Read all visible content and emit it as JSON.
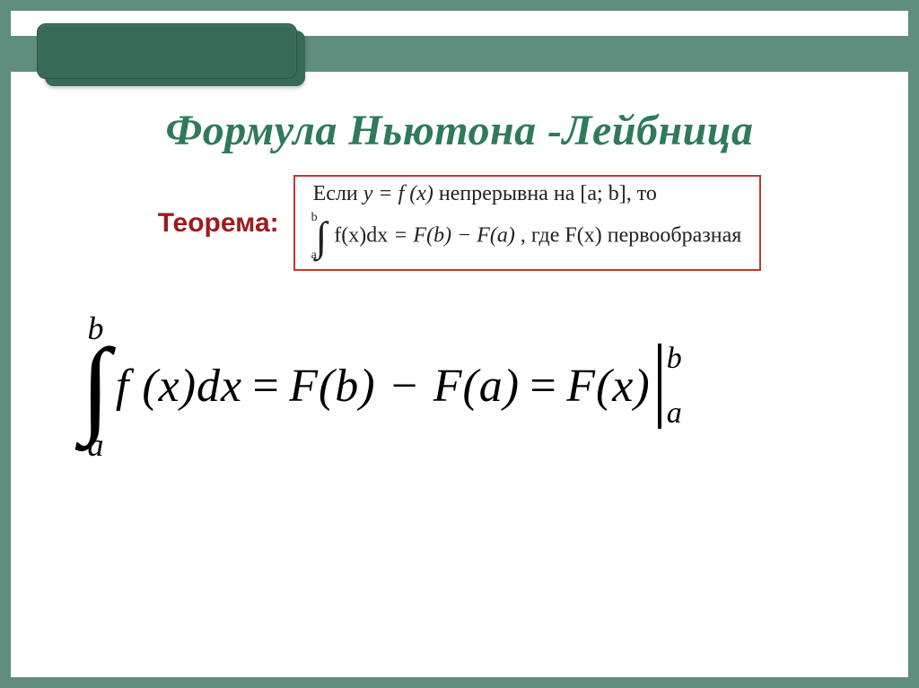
{
  "slide": {
    "title": "Формула Ньютона -Лейбница",
    "theorem_label": "Теорема:",
    "box": {
      "line1_pre": "Если ",
      "line1_fn": "y = f (x)",
      "line1_mid": " непрерывна на ",
      "line1_interval": "[a; b]",
      "line1_post": ", то",
      "line2_upper": "b",
      "line2_lower": "a",
      "line2_lhs": "f(x)dx",
      "line2_eq": " = ",
      "line2_rhs": "F(b) − F(a)",
      "line2_tail": ", где F(x) первообразная"
    },
    "formula": {
      "upper": "b",
      "lower": "a",
      "integrand": "f (x)dx",
      "eq1": "=",
      "term1": "F(b) − F(a)",
      "eq2": "=",
      "term2": "F(x)",
      "eval_upper": "b",
      "eval_lower": "a"
    }
  }
}
